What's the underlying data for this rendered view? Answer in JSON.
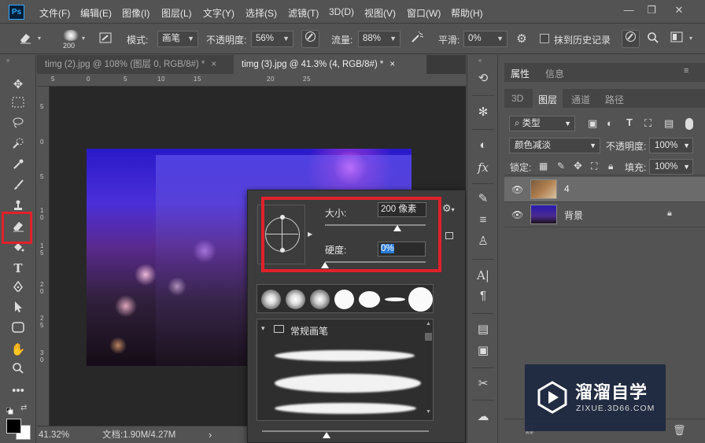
{
  "app": {
    "logo_text": "Ps",
    "menu": [
      "文件(F)",
      "编辑(E)",
      "图像(I)",
      "图层(L)",
      "文字(Y)",
      "选择(S)",
      "滤镜(T)",
      "3D(D)",
      "视图(V)",
      "窗口(W)",
      "帮助(H)"
    ],
    "window_buttons": [
      "—",
      "❐",
      "✕"
    ]
  },
  "options": {
    "brush_size": "200",
    "mode_label": "模式:",
    "mode_value": "画笔",
    "opacity_label": "不透明度:",
    "opacity_value": "56%",
    "flow_label": "流量:",
    "flow_value": "88%",
    "smooth_label": "平滑:",
    "smooth_value": "0%",
    "history_label": "抹到历史记录"
  },
  "tabs": [
    {
      "label": "timg (2).jpg @ 108% (图层 0, RGB/8#) *",
      "close": "×",
      "active": false
    },
    {
      "label": "timg (3).jpg @ 41.3% (4, RGB/8#) *",
      "close": "×",
      "active": true
    }
  ],
  "rulers": {
    "top": [
      "5",
      "0",
      "5",
      "1",
      "0",
      "1",
      "5",
      "2",
      "0",
      "2",
      "5"
    ],
    "left": [
      "5",
      "0",
      "5",
      "1",
      "0",
      "1",
      "5",
      "2",
      "0",
      "2",
      "5",
      "3",
      "0"
    ]
  },
  "status": {
    "zoom": "41.32%",
    "doc_info": "文档:1.90M/4.27M",
    "arrow": "›"
  },
  "brush_popup": {
    "size_label": "大小:",
    "size_value": "200 像素",
    "size_fraction": 0.72,
    "hardness_label": "硬度:",
    "hardness_value": "0%",
    "hardness_fraction": 0.0,
    "folder_label": "常规画笔"
  },
  "right_panel": {
    "top_tabs": [
      "属性",
      "信息"
    ],
    "tabs": [
      "3D",
      "图层",
      "通道",
      "路径"
    ],
    "filter_label": "类型",
    "blend_mode": "颜色减淡",
    "opacity_label": "不透明度:",
    "opacity_value": "100%",
    "lock_label": "锁定:",
    "fill_label": "填充:",
    "fill_value": "100%",
    "layers": [
      {
        "name": "4",
        "selected": true
      },
      {
        "name": "背景",
        "selected": false
      }
    ]
  },
  "watermark": {
    "title": "溜溜自学",
    "url": "ZIXUE.3D66.COM"
  },
  "colors": {
    "highlight": "#e0212b",
    "panel_bg": "#535353",
    "canvas_bg": "#282828"
  }
}
